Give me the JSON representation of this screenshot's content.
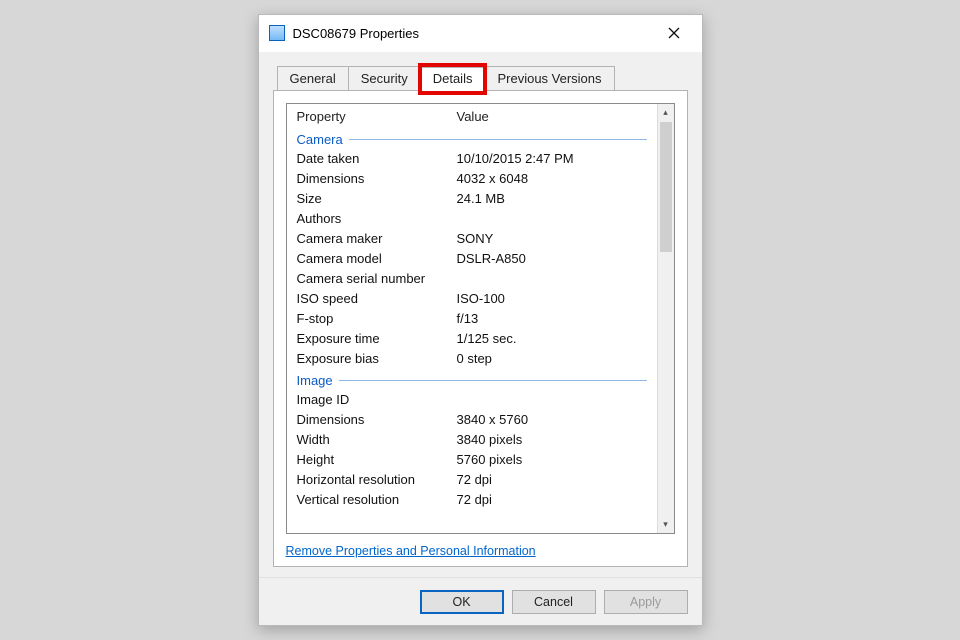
{
  "title": "DSC08679 Properties",
  "tabs": {
    "general": "General",
    "security": "Security",
    "details": "Details",
    "previous": "Previous Versions"
  },
  "headers": {
    "property": "Property",
    "value": "Value"
  },
  "groups": {
    "camera": {
      "title": "Camera",
      "rows": [
        {
          "p": "Date taken",
          "v": "10/10/2015 2:47 PM"
        },
        {
          "p": "Dimensions",
          "v": "4032 x 6048"
        },
        {
          "p": "Size",
          "v": "24.1 MB"
        },
        {
          "p": "Authors",
          "v": ""
        },
        {
          "p": "Camera maker",
          "v": "SONY"
        },
        {
          "p": "Camera model",
          "v": "DSLR-A850"
        },
        {
          "p": "Camera serial number",
          "v": ""
        },
        {
          "p": "ISO speed",
          "v": "ISO-100"
        },
        {
          "p": "F-stop",
          "v": "f/13"
        },
        {
          "p": "Exposure time",
          "v": "1/125 sec."
        },
        {
          "p": "Exposure bias",
          "v": "0 step"
        }
      ]
    },
    "image": {
      "title": "Image",
      "rows": [
        {
          "p": "Image ID",
          "v": ""
        },
        {
          "p": "Dimensions",
          "v": "3840 x 5760"
        },
        {
          "p": "Width",
          "v": "3840 pixels"
        },
        {
          "p": "Height",
          "v": "5760 pixels"
        },
        {
          "p": "Horizontal resolution",
          "v": "72 dpi"
        },
        {
          "p": "Vertical resolution",
          "v": "72 dpi"
        }
      ]
    }
  },
  "link": "Remove Properties and Personal Information",
  "buttons": {
    "ok": "OK",
    "cancel": "Cancel",
    "apply": "Apply"
  }
}
